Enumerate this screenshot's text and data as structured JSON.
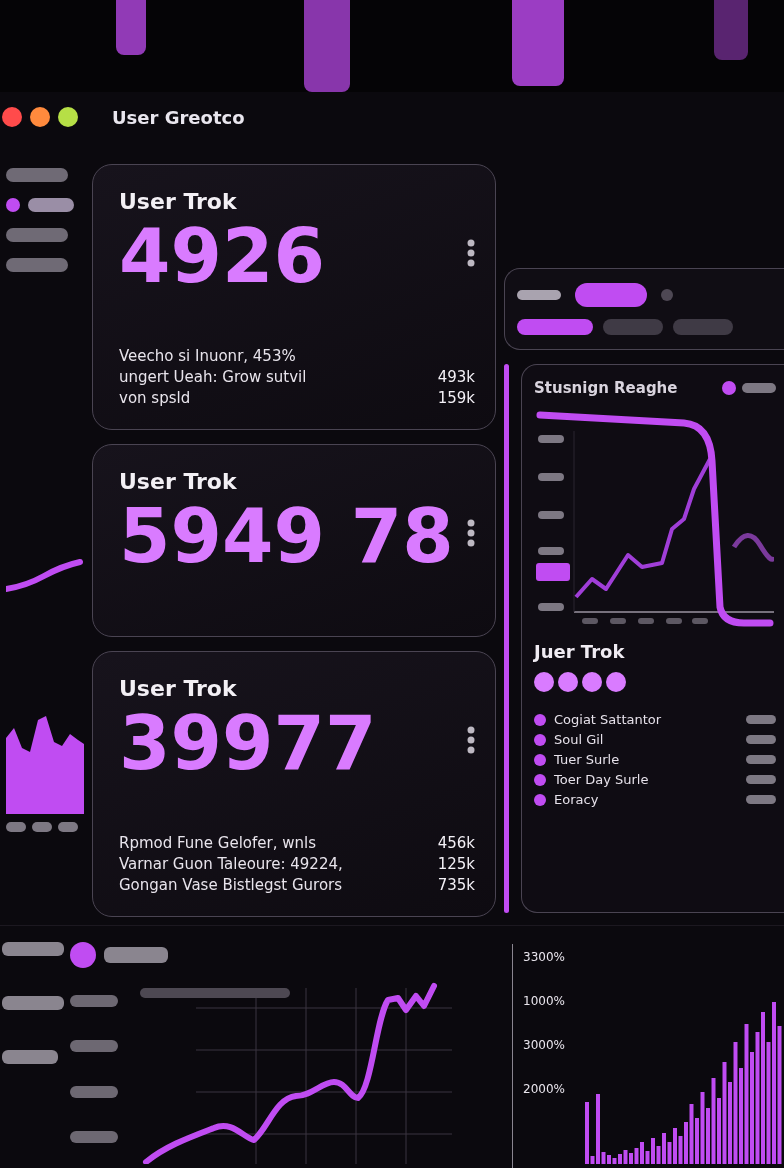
{
  "window": {
    "title": "User Greotco"
  },
  "sidebar": {
    "items": [
      {
        "selected": false
      },
      {
        "selected": true
      },
      {
        "selected": false
      },
      {
        "selected": false
      }
    ]
  },
  "cards": [
    {
      "title": "User Trok",
      "value": "4926",
      "lines": [
        "Veecho si Inuonr, 453%",
        "ungert Ueah: Grow sutvil",
        "von spsld"
      ],
      "figures": [
        "493k",
        "159k"
      ]
    },
    {
      "title": "User Trok",
      "value": "5949 78"
    },
    {
      "title": "User Trok",
      "value": "39977",
      "lines": [
        "Rpmod Fune Gelofer, wnls",
        "Varnar Guon Taleoure: 49224,",
        "Gongan Vase Bistlegst Gurors"
      ],
      "figures": [
        "456k",
        "125k",
        "735k"
      ]
    }
  ],
  "panel": {
    "tabs": [
      {
        "selected": true
      },
      {
        "selected": false
      },
      {
        "selected": false
      }
    ],
    "chart_title": "Stusnign Reaghe",
    "legend_title": "Juer Trok",
    "legend_items": [
      "Cogiat Sattantor",
      "Soul Gil",
      "Tuer Surle",
      "Toer Day Surle",
      "Eoracy"
    ]
  },
  "bar_chart": {
    "y_labels": [
      "3300%",
      "1000%",
      "3000%",
      "2000%"
    ]
  }
}
